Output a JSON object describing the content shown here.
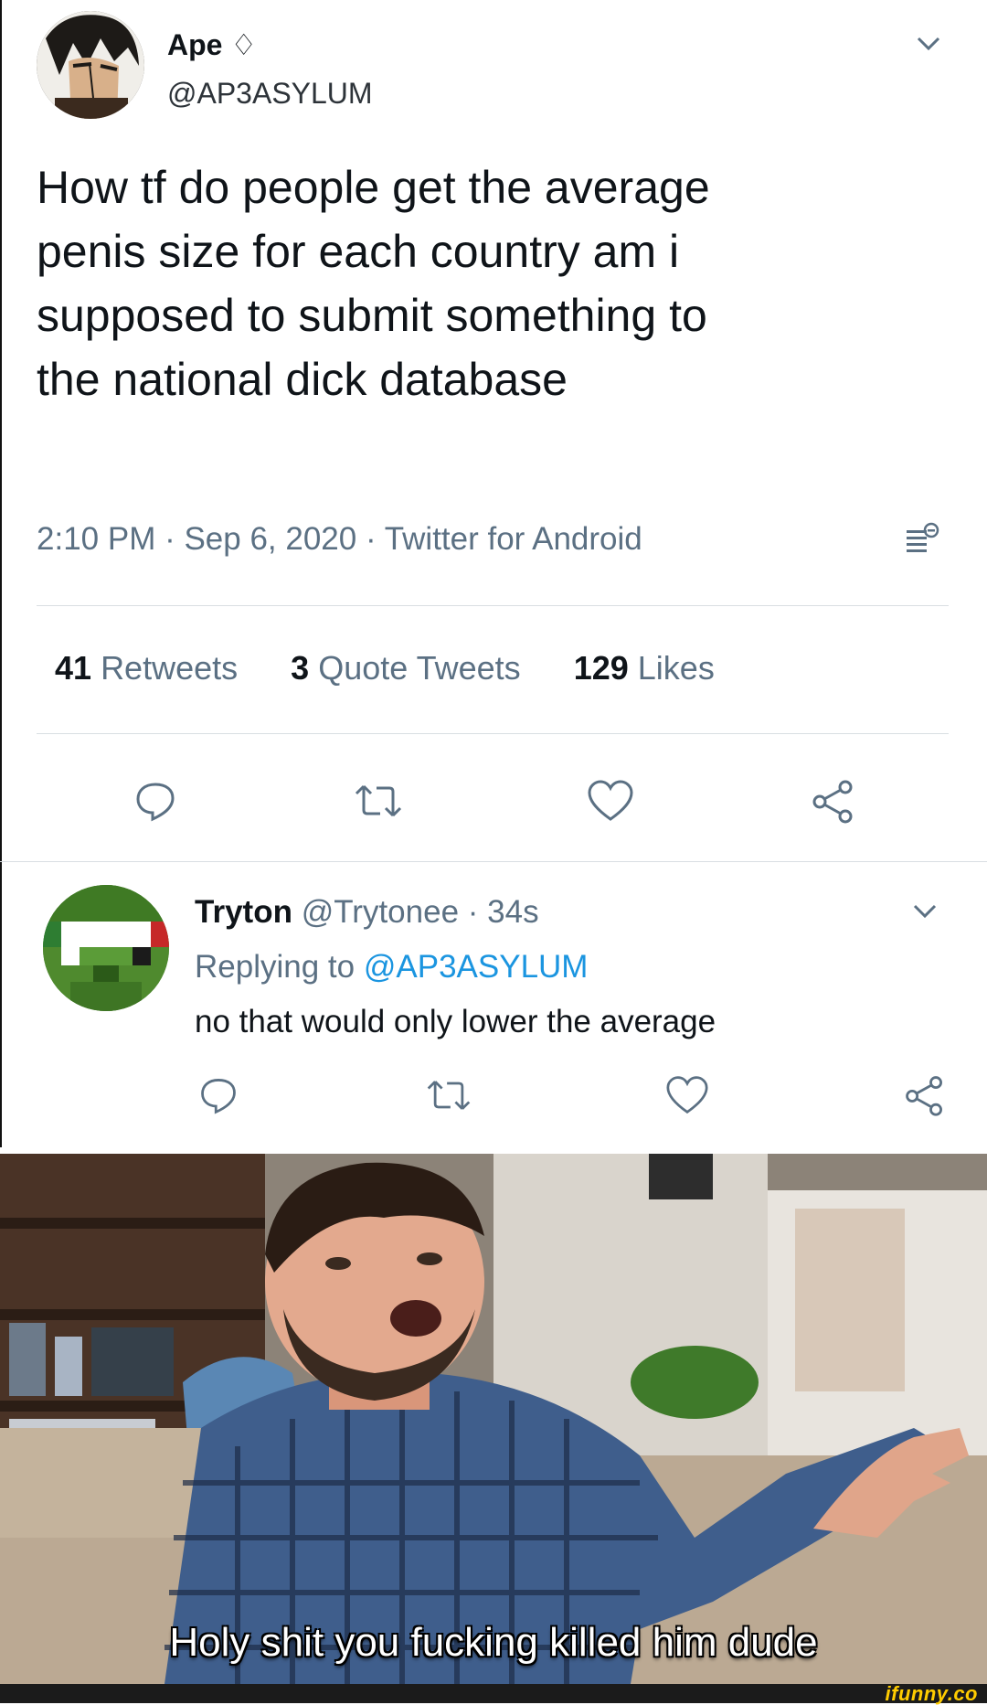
{
  "tweet": {
    "display_name": "Ape",
    "name_badge": "♢",
    "handle": "@AP3ASYLUM",
    "text_lines": [
      "How tf do people get the average",
      "penis size for each country am i",
      "supposed to submit something to",
      "the national dick database"
    ],
    "meta": "2:10 PM · Sep 6, 2020 · Twitter for Android",
    "stats": {
      "retweets_count": "41",
      "retweets_label": "Retweets",
      "quotes_count": "3",
      "quotes_label": "Quote Tweets",
      "likes_count": "129",
      "likes_label": "Likes"
    }
  },
  "reply": {
    "display_name": "Tryton",
    "handle_time": "@Trytonee · 34s",
    "replying_prefix": "Replying to",
    "replying_handle": "@AP3ASYLUM",
    "text": "no that would only lower the average"
  },
  "meme": {
    "caption": "Holy shit you fucking killed him dude"
  },
  "watermark": "ifunny.co",
  "colors": {
    "link": "#1b95e0",
    "muted": "#5b7083",
    "text": "#0f1419"
  },
  "icons": [
    "chevron-down-icon",
    "analytics-icon",
    "reply-icon",
    "retweet-icon",
    "like-icon",
    "share-icon"
  ]
}
